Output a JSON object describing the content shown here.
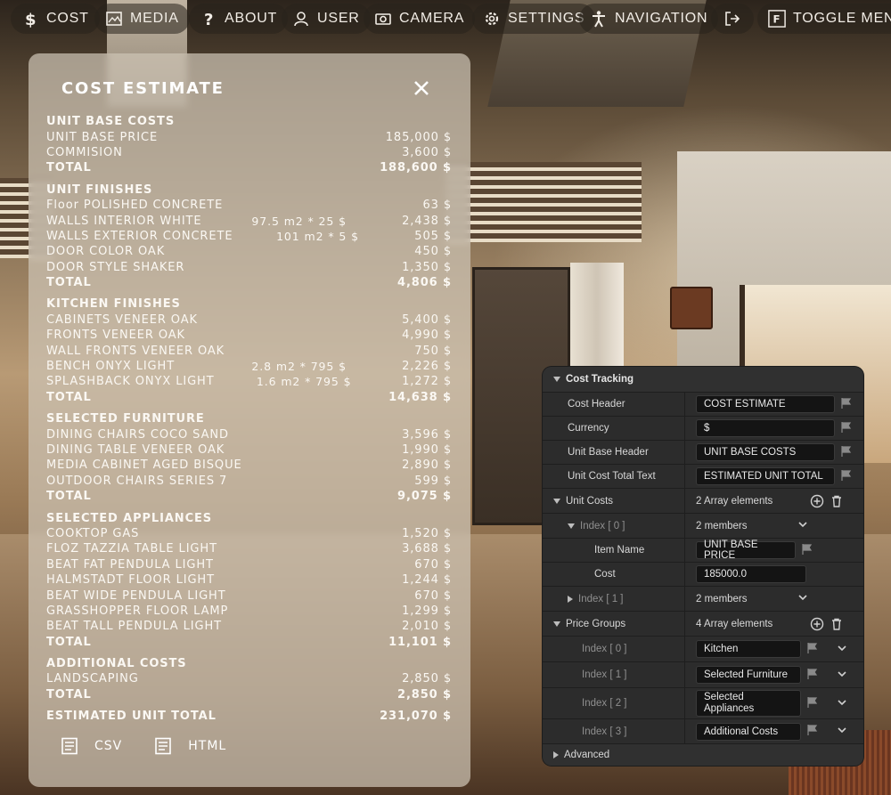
{
  "nav": [
    {
      "icon": "dollar-icon",
      "label": "COST"
    },
    {
      "icon": "image-icon",
      "label": "MEDIA"
    },
    {
      "icon": "question-icon",
      "label": "ABOUT"
    },
    {
      "icon": "user-icon",
      "label": "USER"
    },
    {
      "icon": "camera-icon",
      "label": "CAMERA"
    },
    {
      "icon": "gear-icon",
      "label": "SETTINGS"
    },
    {
      "icon": "person-icon",
      "label": "NAVIGATION"
    },
    {
      "icon": "exit-icon",
      "label": ""
    },
    {
      "icon": "key-f-icon",
      "label": "TOGGLE MENU"
    }
  ],
  "cost_estimate": {
    "title": "COST ESTIMATE",
    "sections": [
      {
        "header": "UNIT BASE COSTS",
        "items": [
          {
            "name": "UNIT BASE PRICE",
            "calc": "",
            "value": "185,000 $"
          },
          {
            "name": "COMMISION",
            "calc": "",
            "value": "3,600 $"
          }
        ],
        "total_label": "TOTAL",
        "total": "188,600 $"
      },
      {
        "header": "UNIT FINISHES",
        "items": [
          {
            "name": "Floor POLISHED CONCRETE",
            "calc": "",
            "value": "63 $"
          },
          {
            "name": "WALLS INTERIOR WHITE",
            "calc": "97.5 m2 * 25 $",
            "value": "2,438 $"
          },
          {
            "name": "WALLS EXTERIOR CONCRETE",
            "calc": "101 m2 * 5 $",
            "value": "505 $"
          },
          {
            "name": "DOOR COLOR OAK",
            "calc": "",
            "value": "450 $"
          },
          {
            "name": "DOOR STYLE SHAKER",
            "calc": "",
            "value": "1,350 $"
          }
        ],
        "total_label": "TOTAL",
        "total": "4,806 $"
      },
      {
        "header": "KITCHEN FINISHES",
        "items": [
          {
            "name": "CABINETS VENEER OAK",
            "calc": "",
            "value": "5,400 $"
          },
          {
            "name": "FRONTS VENEER OAK",
            "calc": "",
            "value": "4,990 $"
          },
          {
            "name": "WALL FRONTS VENEER OAK",
            "calc": "",
            "value": "750 $"
          },
          {
            "name": "BENCH ONYX LIGHT",
            "calc": "2.8 m2 * 795 $",
            "value": "2,226 $"
          },
          {
            "name": "SPLASHBACK ONYX LIGHT",
            "calc": "1.6 m2 * 795 $",
            "value": "1,272 $"
          }
        ],
        "total_label": "TOTAL",
        "total": "14,638 $"
      },
      {
        "header": "SELECTED FURNITURE",
        "items": [
          {
            "name": "DINING CHAIRS COCO SAND",
            "calc": "",
            "value": "3,596 $"
          },
          {
            "name": "DINING TABLE VENEER OAK",
            "calc": "",
            "value": "1,990 $"
          },
          {
            "name": "MEDIA CABINET AGED BISQUE",
            "calc": "",
            "value": "2,890 $"
          },
          {
            "name": "OUTDOOR CHAIRS SERIES 7",
            "calc": "",
            "value": "599 $"
          }
        ],
        "total_label": "TOTAL",
        "total": "9,075 $"
      },
      {
        "header": "SELECTED APPLIANCES",
        "items": [
          {
            "name": "COOKTOP GAS",
            "calc": "",
            "value": "1,520 $"
          },
          {
            "name": "FLOZ TAZZIA TABLE LIGHT",
            "calc": "",
            "value": "3,688 $"
          },
          {
            "name": "BEAT FAT PENDULA LIGHT",
            "calc": "",
            "value": "670 $"
          },
          {
            "name": "HALMSTADT FLOOR LIGHT",
            "calc": "",
            "value": "1,244 $"
          },
          {
            "name": "BEAT WIDE PENDULA LIGHT",
            "calc": "",
            "value": "670 $"
          },
          {
            "name": "GRASSHOPPER FLOOR LAMP",
            "calc": "",
            "value": "1,299 $"
          },
          {
            "name": "BEAT TALL PENDULA LIGHT",
            "calc": "",
            "value": "2,010 $"
          }
        ],
        "total_label": "TOTAL",
        "total": "11,101 $"
      },
      {
        "header": "ADDITIONAL COSTS",
        "items": [
          {
            "name": "LANDSCAPING",
            "calc": "",
            "value": "2,850 $"
          }
        ],
        "total_label": "TOTAL",
        "total": "2,850 $"
      }
    ],
    "grand_total_label": "ESTIMATED UNIT TOTAL",
    "grand_total": "231,070 $",
    "exports": [
      {
        "icon": "document-icon",
        "label": "CSV"
      },
      {
        "icon": "document-icon",
        "label": "HTML"
      }
    ]
  },
  "details": {
    "category": "Cost Tracking",
    "cost_header_label": "Cost Header",
    "cost_header_value": "COST ESTIMATE",
    "currency_label": "Currency",
    "currency_value": "$",
    "unit_base_header_label": "Unit Base Header",
    "unit_base_header_value": "UNIT BASE COSTS",
    "unit_cost_total_label": "Unit Cost Total Text",
    "unit_cost_total_value": "ESTIMATED UNIT TOTAL",
    "unit_costs_label": "Unit Costs",
    "unit_costs_count": "2 Array elements",
    "index0_label": "Index [ 0 ]",
    "index0_members": "2 members",
    "item_name_label": "Item Name",
    "item_name_value": "UNIT BASE PRICE",
    "cost_label": "Cost",
    "cost_value": "185000.0",
    "index1_label": "Index [ 1 ]",
    "index1_members": "2 members",
    "price_groups_label": "Price Groups",
    "price_groups_count": "4 Array elements",
    "groups": [
      {
        "index": "Index [ 0 ]",
        "value": "Kitchen"
      },
      {
        "index": "Index [ 1 ]",
        "value": "Selected Furniture"
      },
      {
        "index": "Index [ 2 ]",
        "value": "Selected Appliances"
      },
      {
        "index": "Index [ 3 ]",
        "value": "Additional Costs"
      }
    ],
    "advanced_label": "Advanced"
  }
}
